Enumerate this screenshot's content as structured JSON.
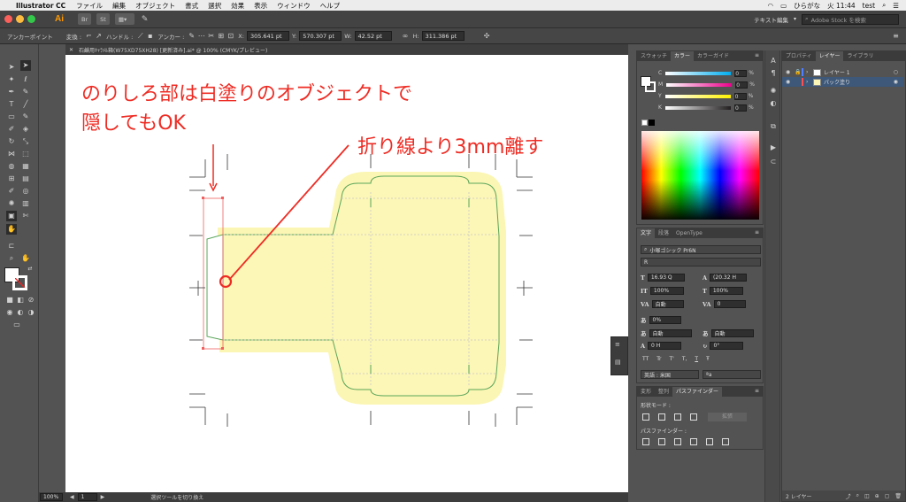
{
  "menubar": {
    "app_name": "Illustrator CC",
    "items": [
      "ファイル",
      "編集",
      "オブジェクト",
      "書式",
      "選択",
      "効果",
      "表示",
      "ウィンドウ",
      "ヘルプ"
    ],
    "input_method": "ひらがな",
    "clock": "火 11:44",
    "user": "test"
  },
  "appbar": {
    "app_logo": "Ai",
    "br_label": "Br",
    "st_label": "St",
    "workspace": "テキスト編集",
    "stock_search_placeholder": "Adobe Stock を検索"
  },
  "control_bar": {
    "anchor_label": "アンカーポイント",
    "convert_label": "変換 :",
    "handle_label": "ハンドル :",
    "anchor2_label": "アンカー :",
    "x_label": "X:",
    "x_value": "305.641 pt",
    "y_label": "Y:",
    "y_value": "570.307 pt",
    "w_label": "W:",
    "w_value": "42.52 pt",
    "h_label": "H:",
    "h_value": "311.386 pt"
  },
  "document": {
    "tab_title": "石鹸用ｷｬﾗﾒﾙ箱(W75XD75XH28) [更新済み].ai* @ 100% (CMYK/プレビュー)",
    "zoom": "100%",
    "page": "1",
    "status_text": "選択ツールを切り換え"
  },
  "annotations": {
    "line1": "のりしろ部は白塗りのオブジェクトで",
    "line2": "隠してもOK",
    "line3": "折り線より3mm離す"
  },
  "color_panel": {
    "tabs": [
      "スウォッチ",
      "カラー",
      "カラーガイド"
    ],
    "channels": [
      {
        "name": "C",
        "value": "0",
        "unit": "%",
        "color": "#00aeef"
      },
      {
        "name": "M",
        "value": "0",
        "unit": "%",
        "color": "#ec008c"
      },
      {
        "name": "Y",
        "value": "0",
        "unit": "%",
        "color": "#fff200"
      },
      {
        "name": "K",
        "value": "0",
        "unit": "%",
        "color": "#231f20"
      }
    ]
  },
  "type_panel": {
    "tabs": [
      "文字",
      "段落",
      "OpenType"
    ],
    "font_family": "小塚ゴシック Pr6N",
    "font_style": "R",
    "font_size": "16.93 Q",
    "leading": "(20.32 H",
    "vscale": "100%",
    "hscale": "100%",
    "kerning": "自動",
    "tracking": "0",
    "tsume": "0%",
    "aki_left": "自動",
    "aki_right": "自動",
    "baseline": "0 H",
    "rotation": "0°",
    "language": "英語 : 米国",
    "aa": "ªa",
    "style_buttons": [
      "TT",
      "Tr",
      "T'",
      "T,",
      "T",
      "Ŧ"
    ]
  },
  "pathfinder_panel": {
    "tabs": [
      "変形",
      "整列",
      "パスファインダー"
    ],
    "shape_modes_label": "形状モード :",
    "expand_label": "拡張",
    "pathfinder_label": "パスファインダー :"
  },
  "layers_panel": {
    "tabs": [
      "プロパティ",
      "レイヤー",
      "ライブラリ"
    ],
    "layers": [
      {
        "name": "レイヤー 1",
        "color": "#4f80ff"
      },
      {
        "name": "パック塗り",
        "color": "#ff4f4f"
      }
    ],
    "footer_count": "2 レイヤー"
  },
  "icons": [
    "apple-icon",
    "selection-tool-icon",
    "pen-tool-icon",
    "type-tool-icon",
    "hand-tool-icon",
    "zoom-tool-icon",
    "eye-icon",
    "lock-icon",
    "search-icon",
    "trash-icon"
  ]
}
